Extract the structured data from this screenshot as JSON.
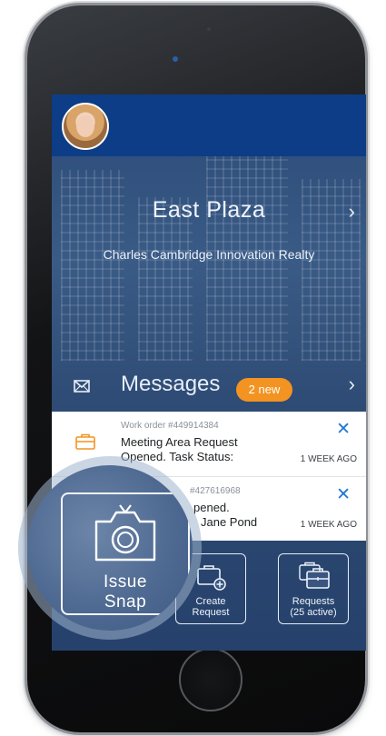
{
  "building": {
    "name": "East Plaza",
    "company": "Charles Cambridge Innovation Realty"
  },
  "messages": {
    "title": "Messages",
    "badge": "2 new",
    "items": [
      {
        "work_order": "Work order #449914384",
        "title_line1": "Meeting Area Request",
        "title_line2": "Opened. Task Status:",
        "time": "1 WEEK AGO"
      },
      {
        "work_order": "#427616968",
        "title_line1": "pened.",
        "title_line2": "Jane Pond",
        "time": "1 WEEK AGO"
      }
    ]
  },
  "actions": {
    "issue_snap": "Issue Snap",
    "create_request": "Create Request",
    "requests": "Requests",
    "requests_count": "(25 active)"
  },
  "colors": {
    "topbar": "#0c3d86",
    "badge": "#f39322",
    "close": "#1f77d6"
  }
}
